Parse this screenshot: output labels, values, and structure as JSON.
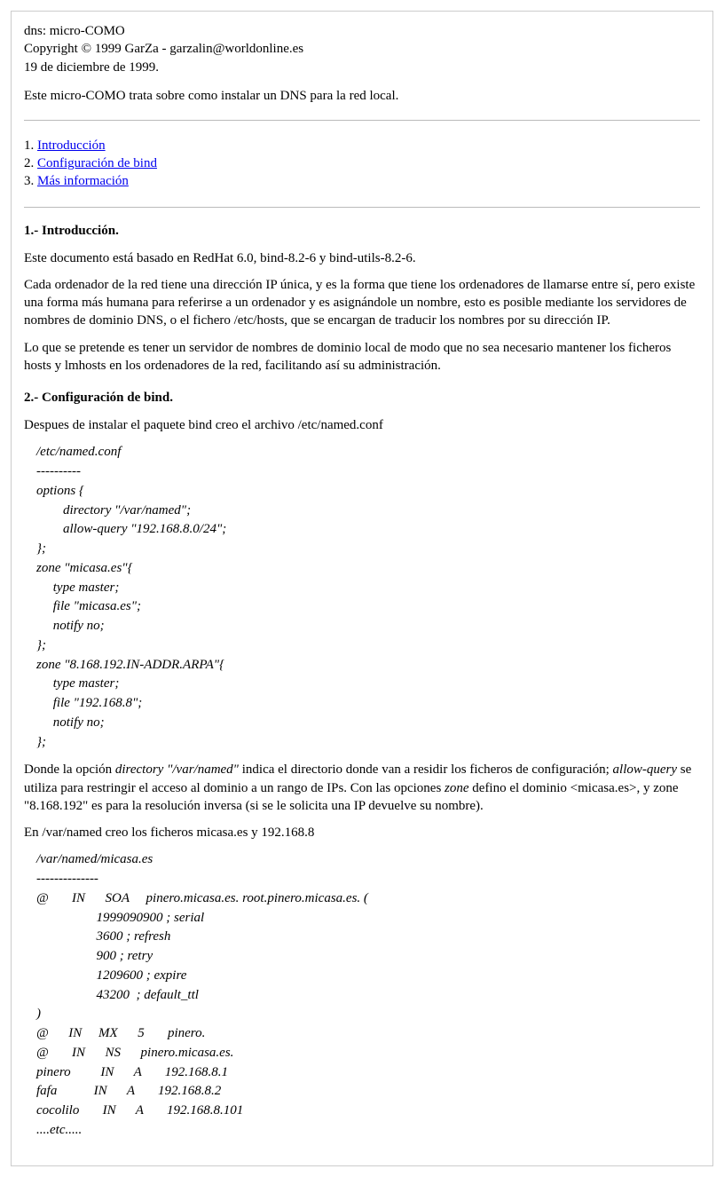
{
  "header": {
    "title": "dns: micro-COMO",
    "copyright": "Copyright © 1999 GarZa  -  garzalin@worldonline.es",
    "date": "19 de diciembre de 1999.",
    "intro": "Este micro-COMO trata sobre como instalar un DNS para la red local."
  },
  "toc": {
    "items": [
      {
        "num": "1.",
        "label": "Introducción"
      },
      {
        "num": "2.",
        "label": "Configuración de bind"
      },
      {
        "num": "3.",
        "label": "Más información "
      }
    ]
  },
  "sections": {
    "s1": {
      "heading": "1.- Introducción.",
      "p1": "Este documento está basado en RedHat 6.0, bind-8.2-6 y bind-utils-8.2-6.",
      "p2": "Cada ordenador de la red tiene una dirección IP única, y es la forma que tiene los ordenadores de llamarse entre sí, pero existe una forma más humana para referirse a un ordenador y es asignándole un nombre, esto es posible mediante los servidores de nombres de dominio DNS, o el fichero /etc/hosts, que se encargan de traducir los nombres por su dirección IP.",
      "p3": "Lo que se pretende es tener un servidor de nombres de dominio local de modo que no sea necesario mantener los ficheros hosts y lmhosts en los ordenadores de la red, facilitando así su administración."
    },
    "s2": {
      "heading": "2.- Configuración de bind.",
      "p1": "Despues de instalar el paquete bind creo el archivo /etc/named.conf",
      "code1": "/etc/named.conf\n----------\noptions {\n        directory \"/var/named\";\n        allow-query \"192.168.8.0/24\";\n};\nzone \"micasa.es\"{\n     type master;\n     file \"micasa.es\";\n     notify no;\n};\nzone \"8.168.192.IN-ADDR.ARPA\"{\n     type master;\n     file \"192.168.8\";\n     notify no;\n};",
      "explain": {
        "pre1": "Donde la opción ",
        "i1": "directory \"/var/named\"",
        "mid1": " indica el directorio donde van a residir los ficheros de configuración; ",
        "i2": "allow-query",
        "mid2": " se utiliza para restringir el acceso al dominio a un rango de IPs. Con las opciones ",
        "i3": "zone",
        "mid3": " defino el dominio <micasa.es>, y zone \"8.168.192\" es para la resolución inversa (si se le solicita una IP devuelve su nombre)."
      },
      "p3": "En /var/named creo los ficheros micasa.es y 192.168.8",
      "code2": "/var/named/micasa.es\n--------------\n@       IN      SOA     pinero.micasa.es. root.pinero.micasa.es. (\n                  1999090900 ; serial\n                  3600 ; refresh\n                  900 ; retry\n                  1209600 ; expire\n                  43200  ; default_ttl\n)\n@      IN     MX      5       pinero.\n@       IN      NS      pinero.micasa.es.\npinero         IN      A       192.168.8.1\nfafa           IN      A       192.168.8.2\ncocolilo       IN      A       192.168.8.101\n....etc....."
    }
  }
}
